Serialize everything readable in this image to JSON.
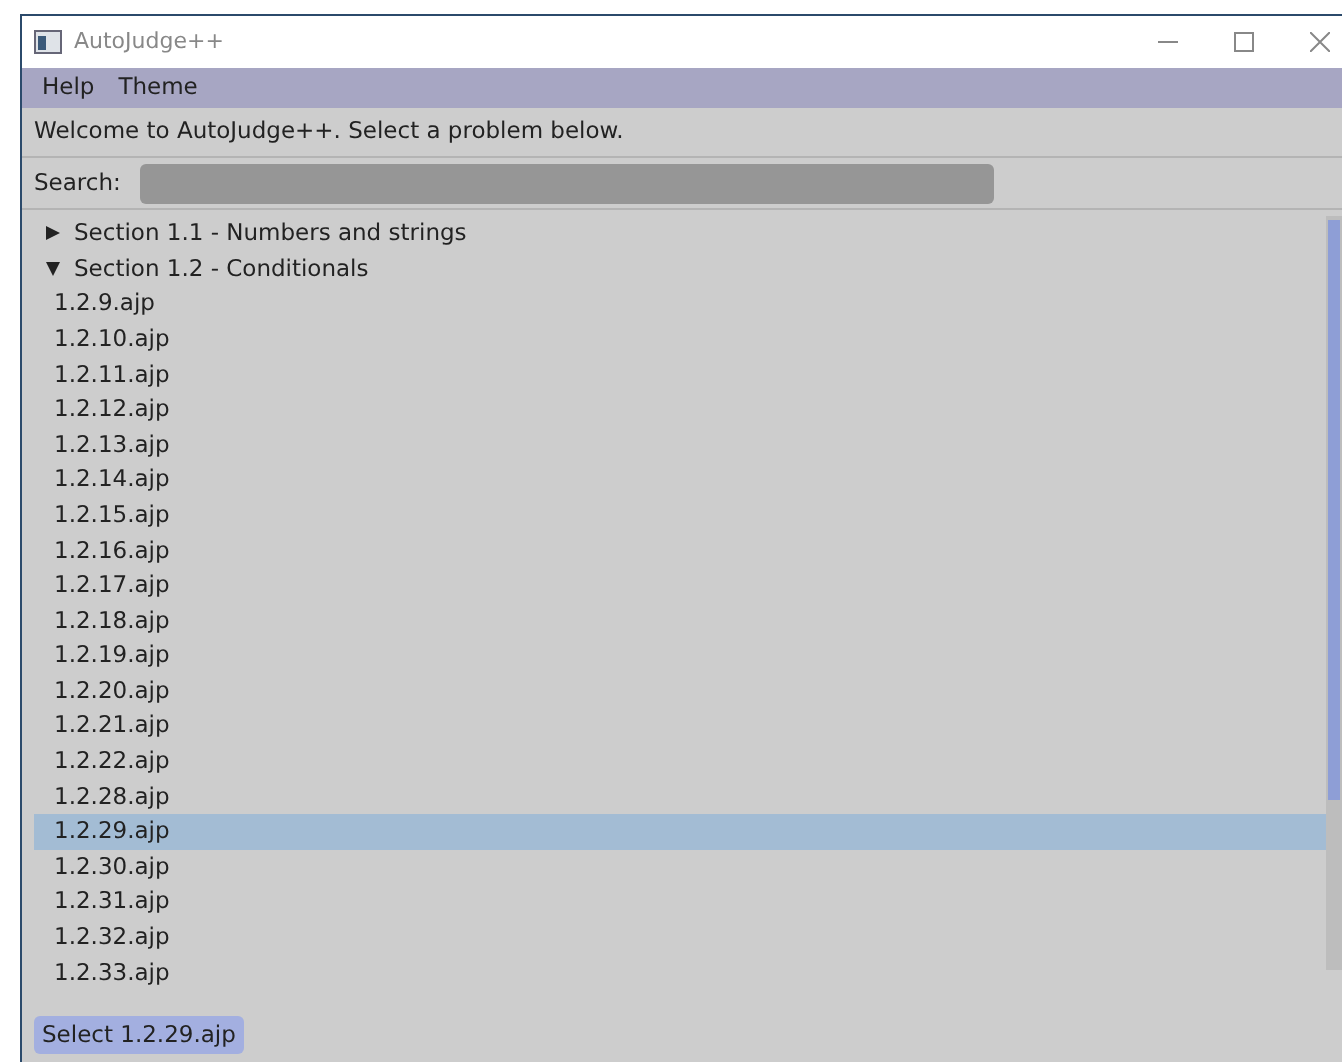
{
  "window": {
    "title": "AutoJudge++"
  },
  "menu": [
    "Help",
    "Theme"
  ],
  "welcome": "Welcome to AutoJudge++. Select a problem below.",
  "search": {
    "label": "Search:"
  },
  "tree": [
    {
      "label": "Section 1.1 - Numbers and strings",
      "expanded": false
    },
    {
      "label": "Section 1.2 - Conditionals",
      "expanded": true,
      "children": [
        {
          "label": "1.2.9.ajp",
          "selected": false
        },
        {
          "label": "1.2.10.ajp",
          "selected": false
        },
        {
          "label": "1.2.11.ajp",
          "selected": false
        },
        {
          "label": "1.2.12.ajp",
          "selected": false
        },
        {
          "label": "1.2.13.ajp",
          "selected": false
        },
        {
          "label": "1.2.14.ajp",
          "selected": false
        },
        {
          "label": "1.2.15.ajp",
          "selected": false
        },
        {
          "label": "1.2.16.ajp",
          "selected": false
        },
        {
          "label": "1.2.17.ajp",
          "selected": false
        },
        {
          "label": "1.2.18.ajp",
          "selected": false
        },
        {
          "label": "1.2.19.ajp",
          "selected": false
        },
        {
          "label": "1.2.20.ajp",
          "selected": false
        },
        {
          "label": "1.2.21.ajp",
          "selected": false
        },
        {
          "label": "1.2.22.ajp",
          "selected": false
        },
        {
          "label": "1.2.28.ajp",
          "selected": false
        },
        {
          "label": "1.2.29.ajp",
          "selected": true
        },
        {
          "label": "1.2.30.ajp",
          "selected": false
        },
        {
          "label": "1.2.31.ajp",
          "selected": false
        },
        {
          "label": "1.2.32.ajp",
          "selected": false
        },
        {
          "label": "1.2.33.ajp",
          "selected": false
        }
      ]
    }
  ],
  "select_button": "Select 1.2.29.ajp"
}
